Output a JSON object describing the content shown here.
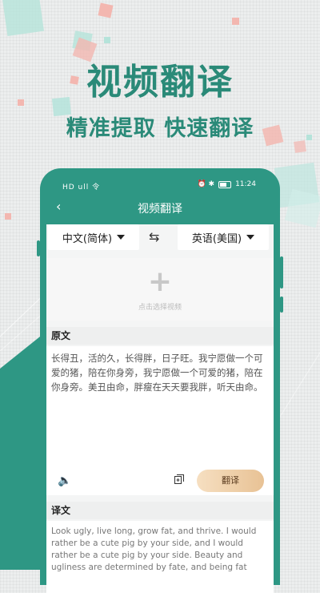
{
  "hero": {
    "title": "视频翻译",
    "subtitle": "精准提取 快速翻译"
  },
  "status_bar": {
    "left_icons": "HD ull 令",
    "right_icons": "⏰ ✱",
    "time": "11:24"
  },
  "nav": {
    "back_icon": "back-arrow-icon",
    "title": "视频翻译"
  },
  "languages": {
    "source": "中文(简体)",
    "target": "英语(美国)",
    "swap_icon": "swap-icon"
  },
  "upload": {
    "hint": "点击选择视频"
  },
  "source_section": {
    "label": "原文",
    "text": "长得丑，活的久，长得胖，日子旺。我宁愿做一个可爱的猪，陪在你身旁，我宁愿做一个可爱的猪，陪在你身旁。美丑由命，胖瘦在天天要我胖，听天由命。"
  },
  "actions": {
    "translate_label": "翻译"
  },
  "target_section": {
    "label": "译文",
    "text": "Look ugly, live long, grow fat, and thrive. I would rather be a cute pig by your side, and I would rather be a cute pig by your side. Beauty and ugliness are determined by fate, and being fat"
  },
  "colors": {
    "accent": "#2e9784",
    "title_green": "#2a8a78",
    "button_gold": "#e8c295"
  }
}
